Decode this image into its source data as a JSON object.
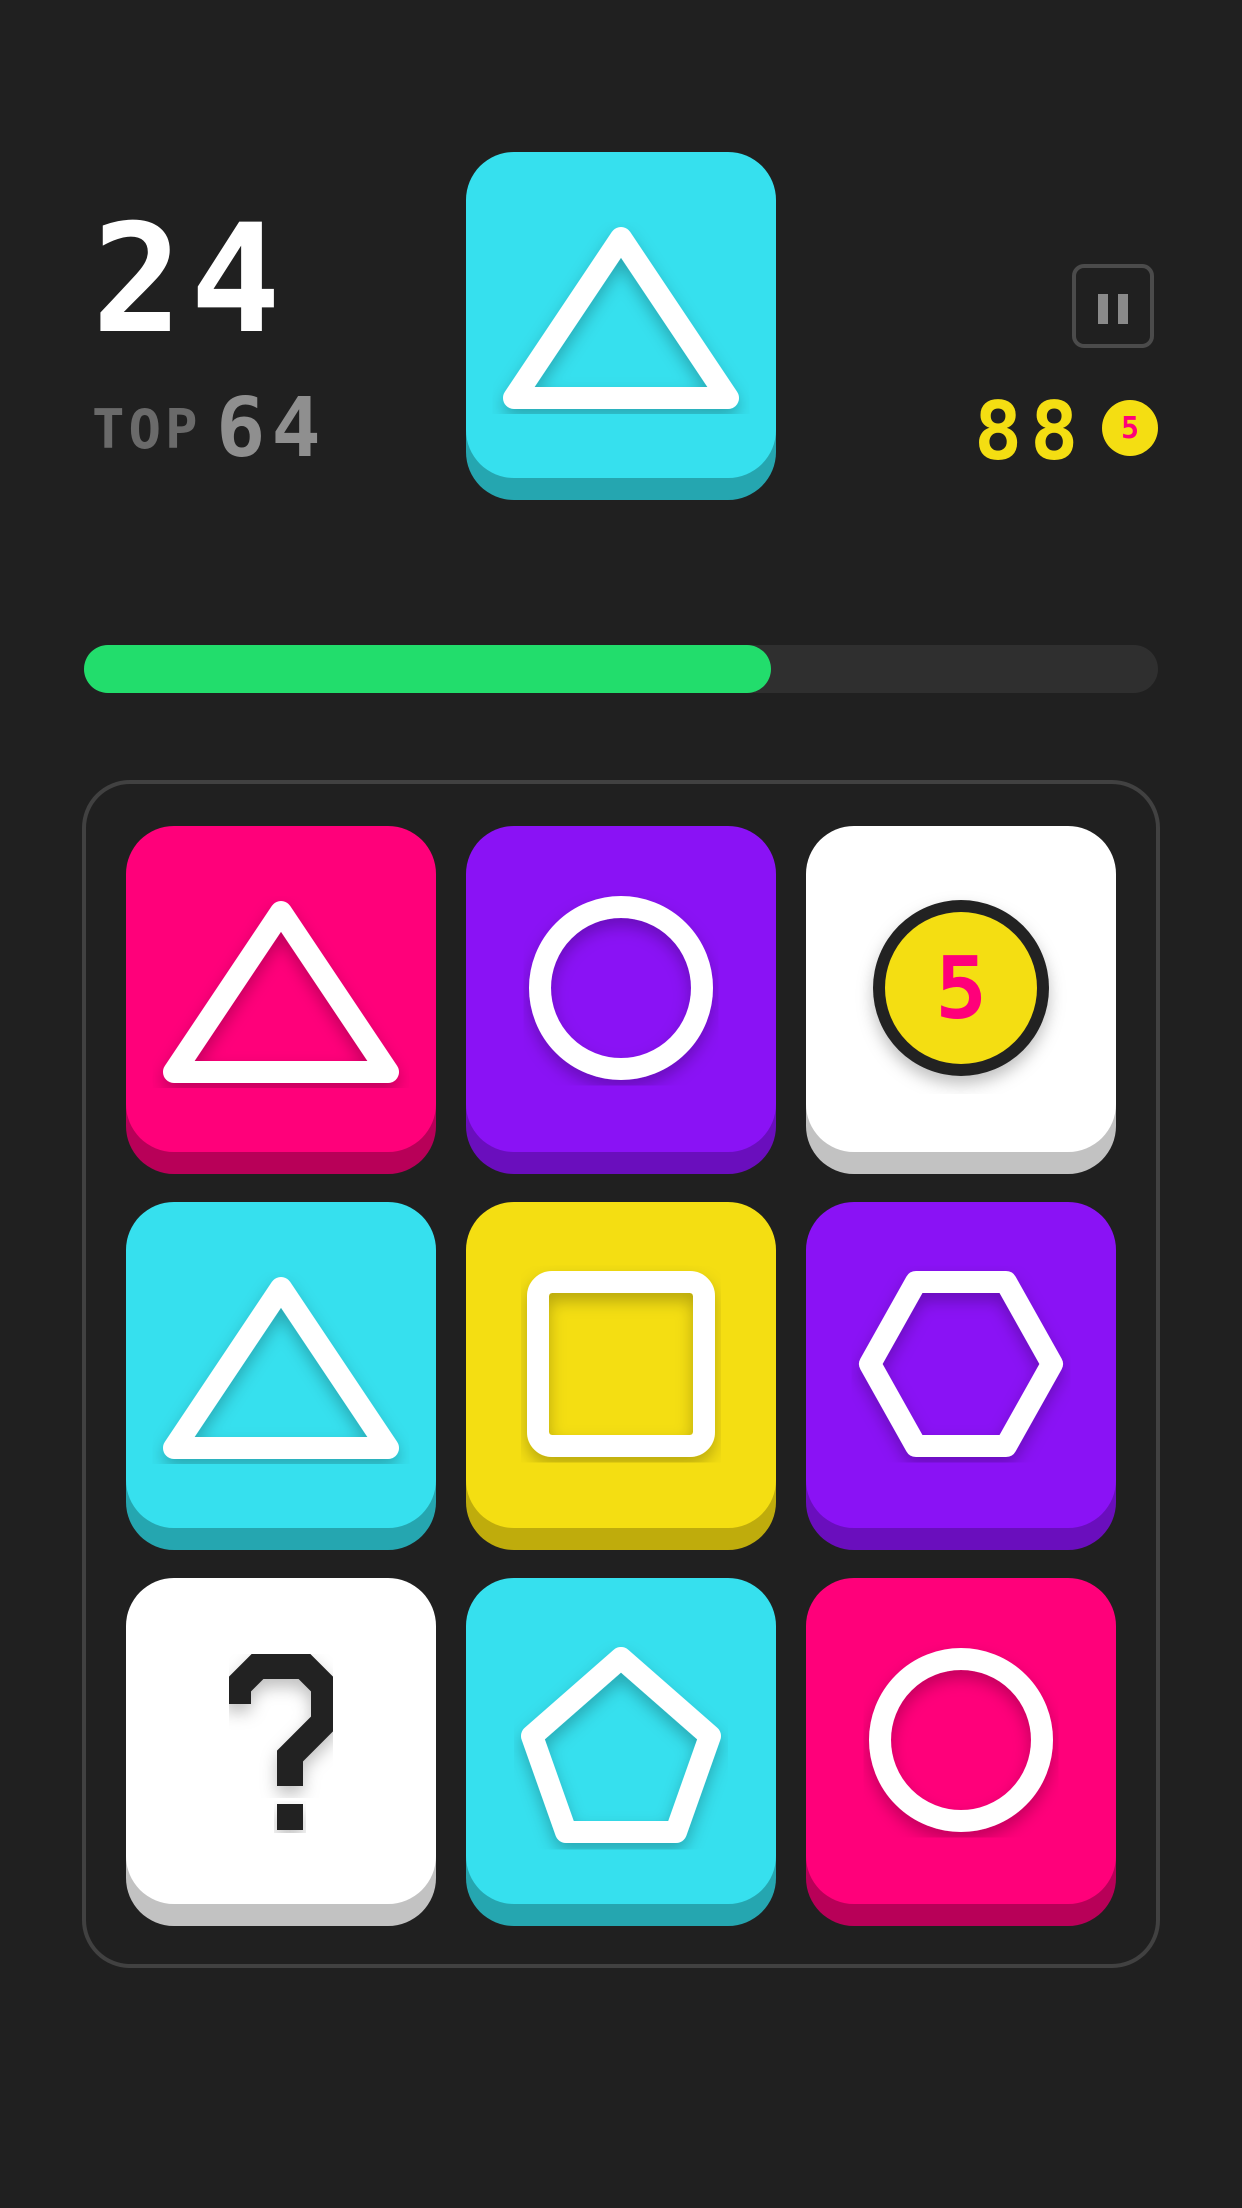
{
  "score": "24",
  "top": {
    "label": "TOP",
    "value": "64"
  },
  "coins": {
    "count": "88",
    "coin_value": "5"
  },
  "progress": 0.64,
  "colors": {
    "background": "#202020",
    "pink": "#ff007a",
    "purple": "#8a12f5",
    "cyan": "#36e0ee",
    "yellow": "#f4de12",
    "white": "#ffffff",
    "green": "#22dd6c"
  },
  "target_tile": {
    "color": "cyan",
    "shape": "triangle-icon"
  },
  "board": [
    {
      "color": "pink",
      "shape": "triangle-icon"
    },
    {
      "color": "purple",
      "shape": "circle-icon"
    },
    {
      "color": "white",
      "shape": "coin-icon",
      "coin_value": "5"
    },
    {
      "color": "cyan",
      "shape": "triangle-icon"
    },
    {
      "color": "yellow",
      "shape": "square-icon"
    },
    {
      "color": "purple",
      "shape": "hexagon-icon"
    },
    {
      "color": "white",
      "shape": "question-icon",
      "text": "?"
    },
    {
      "color": "cyan",
      "shape": "pentagon-icon"
    },
    {
      "color": "pink",
      "shape": "circle-icon"
    }
  ]
}
